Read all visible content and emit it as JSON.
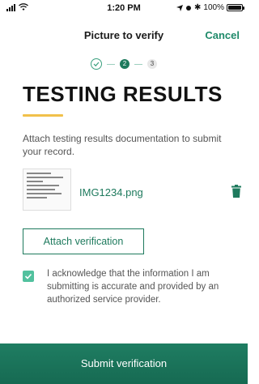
{
  "status": {
    "time": "1:20 PM",
    "battery": "100%",
    "battery_level": 1.0
  },
  "header": {
    "title": "Picture to verify",
    "cancel_label": "Cancel"
  },
  "stepper": {
    "steps": [
      {
        "label": "",
        "state": "done",
        "icon": "check-icon"
      },
      {
        "label": "2",
        "state": "current"
      },
      {
        "label": "3",
        "state": "upcoming"
      }
    ]
  },
  "main": {
    "title": "TESTING RESULTS",
    "description": "Attach testing results documentation to submit your record.",
    "attachment": {
      "file_name": "IMG1234.png",
      "icon": "trash-icon"
    },
    "attach_button_label": "Attach verification",
    "acknowledgement": {
      "checked": true,
      "text": "I acknowledge that the information I am submitting is accurate and provided by an authorized service provider."
    }
  },
  "footer": {
    "submit_label": "Submit verification"
  },
  "colors": {
    "accent": "#1e7a5d",
    "checkbox": "#52c19e",
    "underline": "#f1c14b"
  }
}
